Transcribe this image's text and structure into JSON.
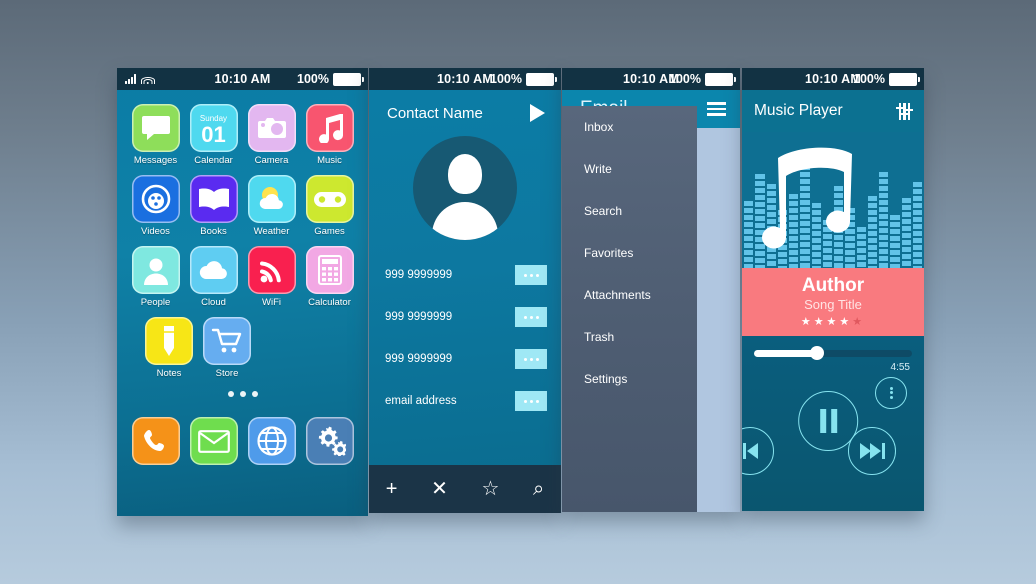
{
  "background": {
    "top_color": "#5c6a78",
    "bottom_color": "#b6cbdd"
  },
  "status_bar": {
    "time": "10:10 AM",
    "battery": "100%"
  },
  "home_screen": {
    "apps": [
      [
        {
          "label": "Messages",
          "icon": "chat-bubble-icon",
          "color": "#8ede5a"
        },
        {
          "label": "Calendar",
          "icon": "calendar-icon",
          "color": "#4fd9ef",
          "day_name": "Sunday",
          "day_number": "01"
        },
        {
          "label": "Camera",
          "icon": "camera-icon",
          "color": "#e3b7f0"
        },
        {
          "label": "Music",
          "icon": "music-note-icon",
          "color": "#f8556f"
        }
      ],
      [
        {
          "label": "Videos",
          "icon": "film-reel-icon",
          "color": "#1a6fe0"
        },
        {
          "label": "Books",
          "icon": "open-book-icon",
          "color": "#5a2bf0"
        },
        {
          "label": "Weather",
          "icon": "sun-cloud-icon",
          "color": "#4fd9ef"
        },
        {
          "label": "Games",
          "icon": "gamepad-icon",
          "color": "#cde82f"
        }
      ],
      [
        {
          "label": "People",
          "icon": "person-icon",
          "color": "#7fe8e0"
        },
        {
          "label": "Cloud",
          "icon": "cloud-icon",
          "color": "#5fcdf2"
        },
        {
          "label": "WiFi",
          "icon": "wifi-signal-icon",
          "color": "#f9204f"
        },
        {
          "label": "Calculator",
          "icon": "calculator-icon",
          "color": "#f2a8e4"
        }
      ],
      [
        {
          "label": "Notes",
          "icon": "pencil-icon",
          "color": "#f7e616"
        },
        {
          "label": "Store",
          "icon": "shopping-cart-icon",
          "color": "#66adf0"
        }
      ]
    ],
    "page_dots": 3,
    "dock": [
      {
        "label": "Phone",
        "icon": "phone-handset-icon",
        "color": "#f59218"
      },
      {
        "label": "Mail",
        "icon": "envelope-icon",
        "color": "#6fdd4e"
      },
      {
        "label": "Browser",
        "icon": "globe-icon",
        "color": "#4f9bea"
      },
      {
        "label": "Settings",
        "icon": "gears-icon",
        "color": "#4a7fb5"
      }
    ]
  },
  "contact_screen": {
    "title": "Contact Name",
    "play_icon": "play-triangle-icon",
    "avatar_icon": "user-avatar-icon",
    "rows": [
      {
        "value": "999 9999999"
      },
      {
        "value": "999 9999999"
      },
      {
        "value": "999 9999999"
      },
      {
        "value": "email address"
      }
    ],
    "more_icon": "ellipsis-icon",
    "toolbar": [
      {
        "label": "+",
        "name": "add-contact-button"
      },
      {
        "label": "✕",
        "name": "delete-contact-button"
      },
      {
        "label": "☆",
        "name": "favorite-contact-button"
      },
      {
        "label": "⌕",
        "name": "search-contact-button"
      }
    ]
  },
  "email_screen": {
    "title": "Email",
    "menu_icon": "hamburger-menu-icon",
    "menu_items": [
      {
        "label": "Inbox",
        "visible_text": "box"
      },
      {
        "label": "Write",
        "visible_text": "rite"
      },
      {
        "label": "Search",
        "visible_text": "earch"
      },
      {
        "label": "Favorites",
        "visible_text": "vorites"
      },
      {
        "label": "Attachments",
        "visible_text": "tachments"
      },
      {
        "label": "Trash",
        "visible_text": "ash"
      },
      {
        "label": "Settings",
        "visible_text": "ettings"
      }
    ]
  },
  "music_screen": {
    "title": "Music Player",
    "equalizer_icon": "equalizer-settings-icon",
    "artwork_icon": "music-note-equalizer-icon",
    "author": "Author",
    "song_title": "Song Title",
    "rating": 4,
    "rating_max": 5,
    "duration": "4:55",
    "progress_percent": 40,
    "controls": [
      {
        "name": "previous-button",
        "icon": "previous-track-icon"
      },
      {
        "name": "play-pause-button",
        "icon": "pause-icon"
      },
      {
        "name": "next-button",
        "icon": "next-track-icon"
      },
      {
        "name": "options-button",
        "icon": "vertical-ellipsis-icon"
      }
    ],
    "accent_color": "#f97a7f",
    "control_color": "#86e3ef"
  }
}
